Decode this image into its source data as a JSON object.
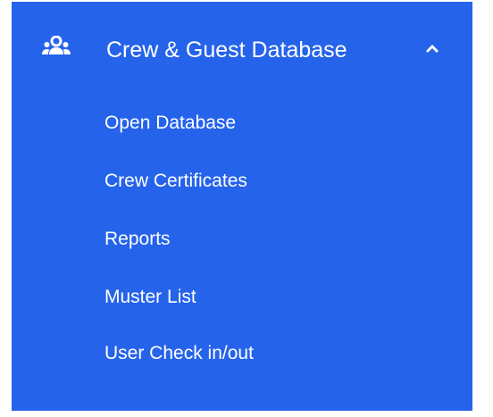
{
  "menu": {
    "header_label": "Crew & Guest Database",
    "header_icon": "users-group-icon",
    "expand_icon": "chevron-up-icon",
    "items": [
      {
        "label": "Open Database"
      },
      {
        "label": "Crew Certificates"
      },
      {
        "label": "Reports"
      },
      {
        "label": "Muster List"
      },
      {
        "label": "User Check in/out"
      }
    ]
  },
  "colors": {
    "panel_background": "#2563eb",
    "text": "#ffffff"
  }
}
